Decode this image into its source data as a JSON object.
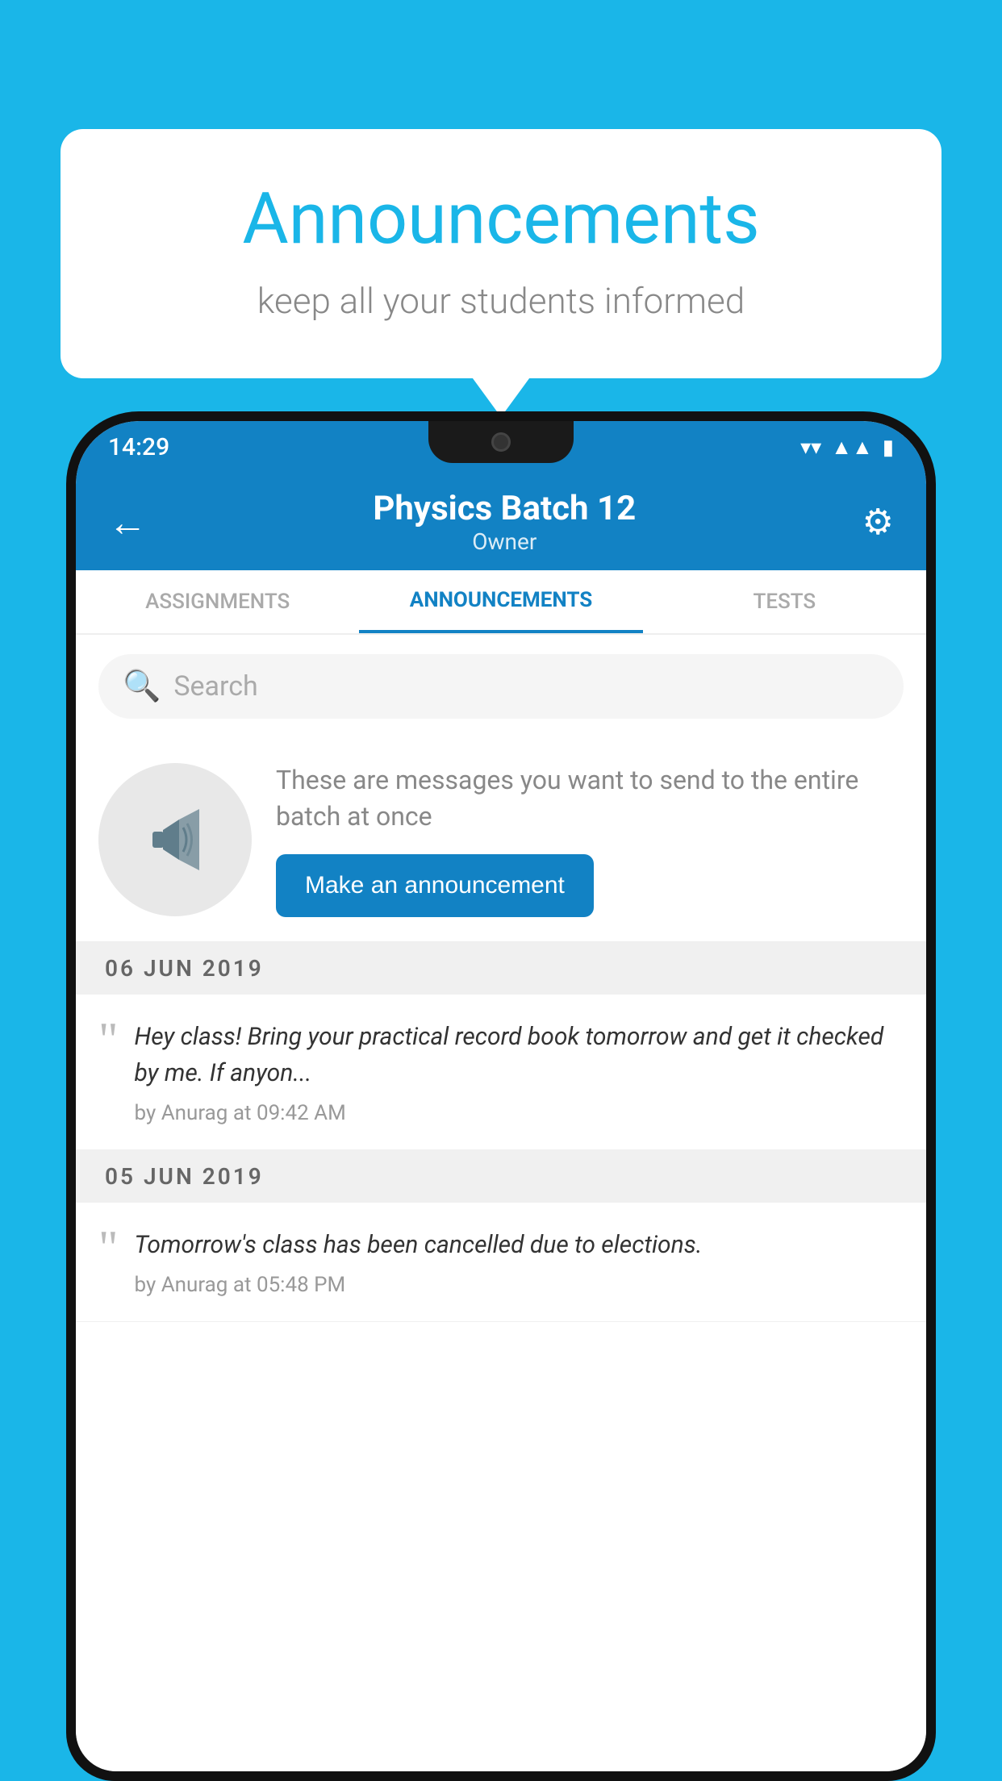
{
  "background_color": "#1ab6e8",
  "speech_bubble": {
    "title": "Announcements",
    "subtitle": "keep all your students informed"
  },
  "status_bar": {
    "time": "14:29",
    "icons": [
      "wifi",
      "signal",
      "battery"
    ]
  },
  "app_bar": {
    "title": "Physics Batch 12",
    "subtitle": "Owner",
    "back_label": "←",
    "gear_label": "⚙"
  },
  "tabs": [
    {
      "label": "ASSIGNMENTS",
      "active": false
    },
    {
      "label": "ANNOUNCEMENTS",
      "active": true
    },
    {
      "label": "TESTS",
      "active": false
    },
    {
      "label": "...",
      "active": false
    }
  ],
  "search": {
    "placeholder": "Search"
  },
  "promo": {
    "description": "These are messages you want to send to the entire batch at once",
    "button_label": "Make an announcement"
  },
  "announcements": [
    {
      "date": "06  JUN  2019",
      "items": [
        {
          "text": "Hey class! Bring your practical record book tomorrow and get it checked by me. If anyon...",
          "meta": "by Anurag at 09:42 AM"
        }
      ]
    },
    {
      "date": "05  JUN  2019",
      "items": [
        {
          "text": "Tomorrow's class has been cancelled due to elections.",
          "meta": "by Anurag at 05:48 PM"
        }
      ]
    }
  ]
}
